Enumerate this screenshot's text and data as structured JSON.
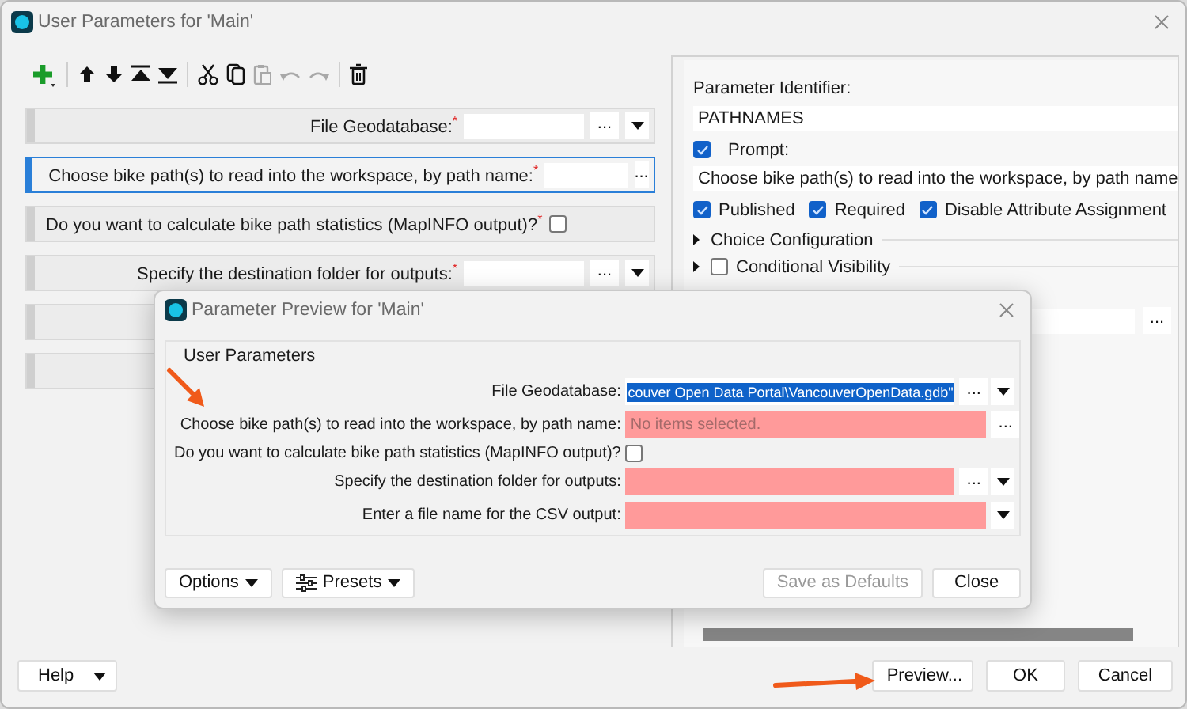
{
  "window": {
    "title": "User Parameters for 'Main'"
  },
  "toolbar": [
    {
      "kind": "add",
      "disabled": false
    },
    {
      "kind": "sep"
    },
    {
      "kind": "up",
      "disabled": false
    },
    {
      "kind": "down",
      "disabled": false
    },
    {
      "kind": "top",
      "disabled": false
    },
    {
      "kind": "bottom",
      "disabled": false
    },
    {
      "kind": "sep"
    },
    {
      "kind": "cut",
      "disabled": false
    },
    {
      "kind": "copy",
      "disabled": false
    },
    {
      "kind": "paste",
      "disabled": true
    },
    {
      "kind": "undo",
      "disabled": true
    },
    {
      "kind": "redo",
      "disabled": true
    },
    {
      "kind": "sep"
    },
    {
      "kind": "delete",
      "disabled": false
    }
  ],
  "parameters": [
    {
      "kind": "file",
      "label": "File Geodatabase:$^{*}$",
      "browse": "...",
      "selected": false
    },
    {
      "kind": "choice",
      "label": "Choose bike path(s) to read into the workspace, by path name:$^{*}$",
      "browse": "...",
      "selected": true
    },
    {
      "kind": "checkbox",
      "label": "Do you want to calculate bike path statistics (MapINFO output)?$^{*}$",
      "checked": false,
      "selected": false
    },
    {
      "kind": "file",
      "label": "Specify the destination folder for outputs:$^{*}$",
      "browse": "...",
      "selected": false
    },
    {
      "kind": "blank",
      "selected": false
    },
    {
      "kind": "blank",
      "selected": false
    }
  ],
  "properties": {
    "identifier_label": "Parameter Identifier:",
    "identifier": "PATHNAMES",
    "prompt": {
      "label": "Prompt:",
      "checked": true,
      "value": "Choose bike path(s) to read into the workspace, by path name"
    },
    "flags": [
      {
        "label": "Published",
        "checked": true
      },
      {
        "label": "Required",
        "checked": true
      },
      {
        "label": "Disable Attribute Assignment",
        "checked": true
      }
    ],
    "sections": [
      {
        "kind": "expander",
        "label": "Choice Configuration"
      },
      {
        "kind": "expander-check",
        "label": "Conditional Visibility",
        "checked": false
      }
    ],
    "extra_browse": "..."
  },
  "buttons": [
    {
      "kind": "menu",
      "label": "Help"
    },
    {
      "kind": "plain",
      "label": "Preview..."
    },
    {
      "kind": "plain",
      "label": "OK"
    },
    {
      "kind": "plain",
      "label": "Cancel"
    }
  ],
  "preview": {
    "title": "Parameter Preview for 'Main'",
    "group": "User Parameters",
    "rows": [
      {
        "kind": "file",
        "label": "File Geodatabase:",
        "value": "couver Open Data Portal\\VancouverOpenData.gdb\"",
        "highlighted": true,
        "invalid": false,
        "browse": "..."
      },
      {
        "kind": "choice",
        "label": "Choose bike path(s) to read into the workspace, by path name:",
        "placeholder": "No items selected.",
        "invalid": true,
        "browse": "..."
      },
      {
        "kind": "checkbox",
        "label": "Do you want to calculate bike path statistics (MapINFO output)?",
        "checked": false
      },
      {
        "kind": "file",
        "label": "Specify the destination folder for outputs:",
        "invalid": true,
        "browse": "..."
      },
      {
        "kind": "text",
        "label": "Enter a file name for the CSV output:",
        "invalid": true
      }
    ],
    "buttons": [
      {
        "kind": "menu",
        "label": "Options",
        "disabled": false
      },
      {
        "kind": "menu-icon",
        "label": "Presets",
        "disabled": false
      },
      {
        "kind": "plain",
        "label": "Save as Defaults",
        "disabled": true
      },
      {
        "kind": "plain",
        "label": "Close",
        "disabled": false
      }
    ]
  }
}
